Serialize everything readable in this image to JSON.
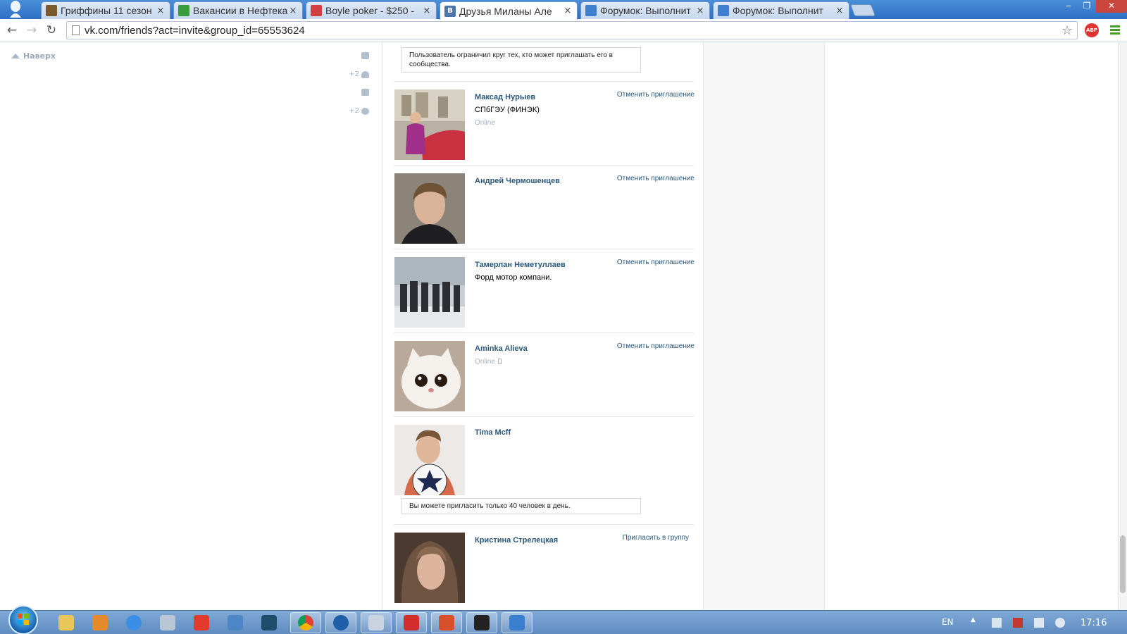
{
  "browser": {
    "tabs": [
      {
        "label": "Гриффины 11 сезон",
        "favicon_color": "#7a5a2a",
        "active": false
      },
      {
        "label": "Вакансии в Нефтека",
        "favicon_color": "#3a9b3a",
        "active": false
      },
      {
        "label": "Boyle poker - $250 -",
        "favicon_color": "#d04040",
        "active": false
      },
      {
        "label": "Друзья Миланы Але",
        "favicon_color": "#4a76a8",
        "favicon_text": "B",
        "active": true
      },
      {
        "label": "Форумок: Выполнит",
        "favicon_color": "#3f7fd0",
        "active": false
      },
      {
        "label": "Форумок: Выполнит",
        "favicon_color": "#3f7fd0",
        "active": false
      }
    ],
    "tab_close_glyph": "×",
    "window_controls": {
      "minimize": "‒",
      "maximize": "❐",
      "close": "✕"
    },
    "nav": {
      "back": "←",
      "forward": "→",
      "reload": "↻"
    },
    "url": "vk.com/friends?act=invite&group_id=65553624",
    "bookmark_star": "☆",
    "adblock_label": "ABP"
  },
  "left": {
    "scroll_up_label": "Наверх",
    "counters": [
      {
        "icon": "envelope-icon",
        "count": ""
      },
      {
        "icon": "friends-icon",
        "count": "+2"
      },
      {
        "icon": "comment-icon",
        "count": ""
      },
      {
        "icon": "gear-icon",
        "count": "+2"
      }
    ]
  },
  "invite": {
    "top_notice": "Пользователь ограничил круг тех, кто может приглашать его в сообщества.",
    "limit_notice": "Вы можете пригласить только 40 человек в день.",
    "people": [
      {
        "name": "Максад Нурыев",
        "info": "СПбГЭУ (ФИНЭК)",
        "status": "Online",
        "mobile": false,
        "action": "Отменить приглашение",
        "avatar": "car"
      },
      {
        "name": "Андрей Чермошенцев",
        "info": "",
        "status": "",
        "mobile": false,
        "action": "Отменить приглашение",
        "avatar": "portrait"
      },
      {
        "name": "Тамерлан Неметуллаев",
        "info": "Форд мотор компани.",
        "status": "",
        "mobile": false,
        "action": "Отменить приглашение",
        "avatar": "group"
      },
      {
        "name": "Aminka Alieva",
        "info": "",
        "status": "Online",
        "mobile": true,
        "action": "Отменить приглашение",
        "avatar": "cat"
      },
      {
        "name": "Tima Mcff",
        "info": "",
        "status": "",
        "mobile": false,
        "action": "",
        "avatar": "ball"
      },
      {
        "name": "Кристина Стрелецкая",
        "info": "",
        "status": "",
        "mobile": false,
        "action": "Пригласить в группу",
        "avatar": "girl"
      }
    ]
  },
  "taskbar": {
    "lang": "EN",
    "tray_arrow": "▲",
    "clock": "17:16"
  }
}
